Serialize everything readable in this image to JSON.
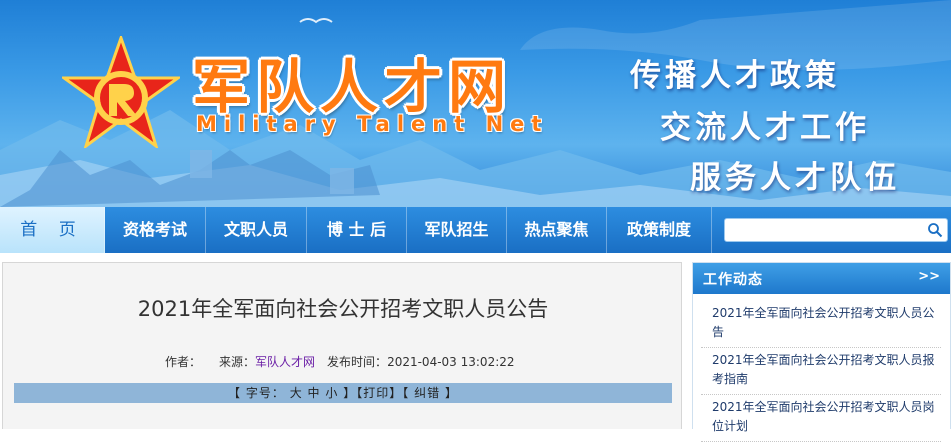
{
  "banner": {
    "title": "军队人才网",
    "subtitle": "Military Talent Net",
    "slogans": [
      "传播人才政策",
      "交流人才工作",
      "服务人才队伍"
    ]
  },
  "nav": {
    "items": [
      "首 页",
      "资格考试",
      "文职人员",
      "博 士 后",
      "军队招生",
      "热点聚焦",
      "政策制度"
    ],
    "active": "首 页",
    "search": {
      "value": "",
      "placeholder": ""
    }
  },
  "article": {
    "title": "2021年全军面向社会公开招考文职人员公告",
    "author_label": "作者：",
    "source_label": "来源：",
    "source": "军队人才网",
    "time_label": "发布时间：",
    "time": "2021-04-03 13:02:22",
    "tools": {
      "open": "【",
      "font_label": "字号：",
      "size_large": "大",
      "size_medium": "中",
      "size_small": "小",
      "mid1": "】【",
      "print": "打印",
      "mid2": "】【",
      "correct": "纠错",
      "close": "】"
    }
  },
  "sidebar": {
    "title": "工作动态",
    "more": ">>",
    "items": [
      "2021年全军面向社会公开招考文职人员公告",
      "2021年全军面向社会公开招考文职人员报考指南",
      "2021年全军面向社会公开招考文职人员岗位计划"
    ]
  },
  "colors": {
    "nav_bg": "#1a6fc4",
    "banner_title": "#ff7a10",
    "tools_bar": "#8fb5d8",
    "source_link": "#6b1fa6"
  }
}
